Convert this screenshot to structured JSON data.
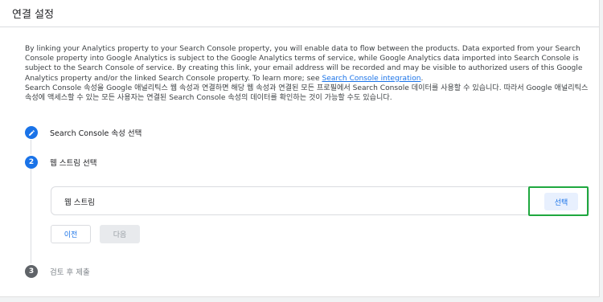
{
  "header": {
    "title": "연결 설정"
  },
  "description": {
    "para1": "By linking your Analytics property to your Search Console property, you will enable data to flow between the products. Data exported from your Search Console property into Google Analytics is subject to the Google Analytics terms of service, while Google Analytics data imported into Search Console is subject to the Search Console of service. By creating this link, your email address will be recorded and may be visible to authorized users of this Google Analytics property and/or the linked Search Console property. To learn more; see ",
    "link": "Search Console integration",
    "para1_end": ".",
    "para2": "Search Console 속성을 Google 애널리틱스 웹 속성과 연결하면 해당 웹 속성과 연결된 모든 프로필에서 Search Console 데이터를 사용할 수 있습니다. 따라서 Google 애널리틱스 속성에 액세스할 수 있는 모든 사용자는 연결된 Search Console 속성의 데이터를 확인하는 것이 가능할 수도 있습니다."
  },
  "steps": [
    {
      "label": "Search Console 속성 선택",
      "icon": "pencil-icon",
      "state": "completed"
    },
    {
      "number": "2",
      "label": "웹 스트림 선택",
      "state": "active"
    },
    {
      "number": "3",
      "label": "검토 후 제출",
      "state": "inactive"
    }
  ],
  "stream_card": {
    "label": "웹 스트림",
    "select_label": "선택"
  },
  "buttons": {
    "prev": "이전",
    "next": "다음"
  },
  "colors": {
    "accent": "#1a73e8",
    "highlight": "#1fa83f",
    "inactive_step": "#5f6368"
  }
}
